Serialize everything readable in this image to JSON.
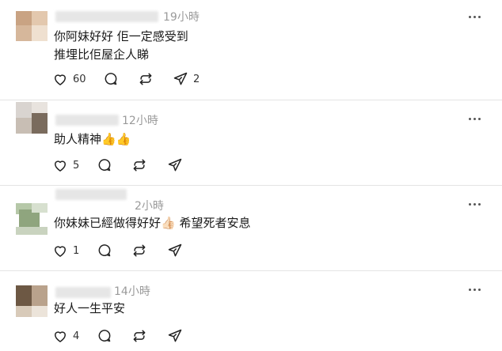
{
  "comments": [
    {
      "time": "19小時",
      "lines": [
        "你阿妹好好 佢一定感受到",
        "推埋比佢屋企人睇"
      ],
      "likes": "60",
      "shares": "2",
      "avatar_colors": [
        "#c9a383",
        "#e3c8ae",
        "#d6b79b",
        "#efe0d0"
      ]
    },
    {
      "time": "12小時",
      "lines": [
        "助人精神"
      ],
      "emoji": "👍👍",
      "likes": "5",
      "shares": "",
      "avatar_colors": [
        "#d9d4d0",
        "#7a6b5d",
        "#c8beb4",
        "#e8e3de"
      ]
    },
    {
      "time": "2小時",
      "lines": [
        "你妹妹已經做得好好"
      ],
      "emoji": "👍🏻",
      "line_tail": " 希望死者安息",
      "likes": "1",
      "shares": "",
      "avatar_colors": [
        "#b6c8a8",
        "#8fa57e",
        "#d7e0cf",
        "#c9d3bf"
      ]
    },
    {
      "time": "14小時",
      "lines": [
        "好人一生平安"
      ],
      "likes": "4",
      "shares": "",
      "avatar_colors": [
        "#6d5844",
        "#b9a28c",
        "#d8cab9",
        "#ece4da"
      ]
    }
  ],
  "icons": {
    "like": "heart-icon",
    "reply": "comment-icon",
    "repost": "repost-icon",
    "share": "send-icon",
    "more": "more-options-icon"
  }
}
